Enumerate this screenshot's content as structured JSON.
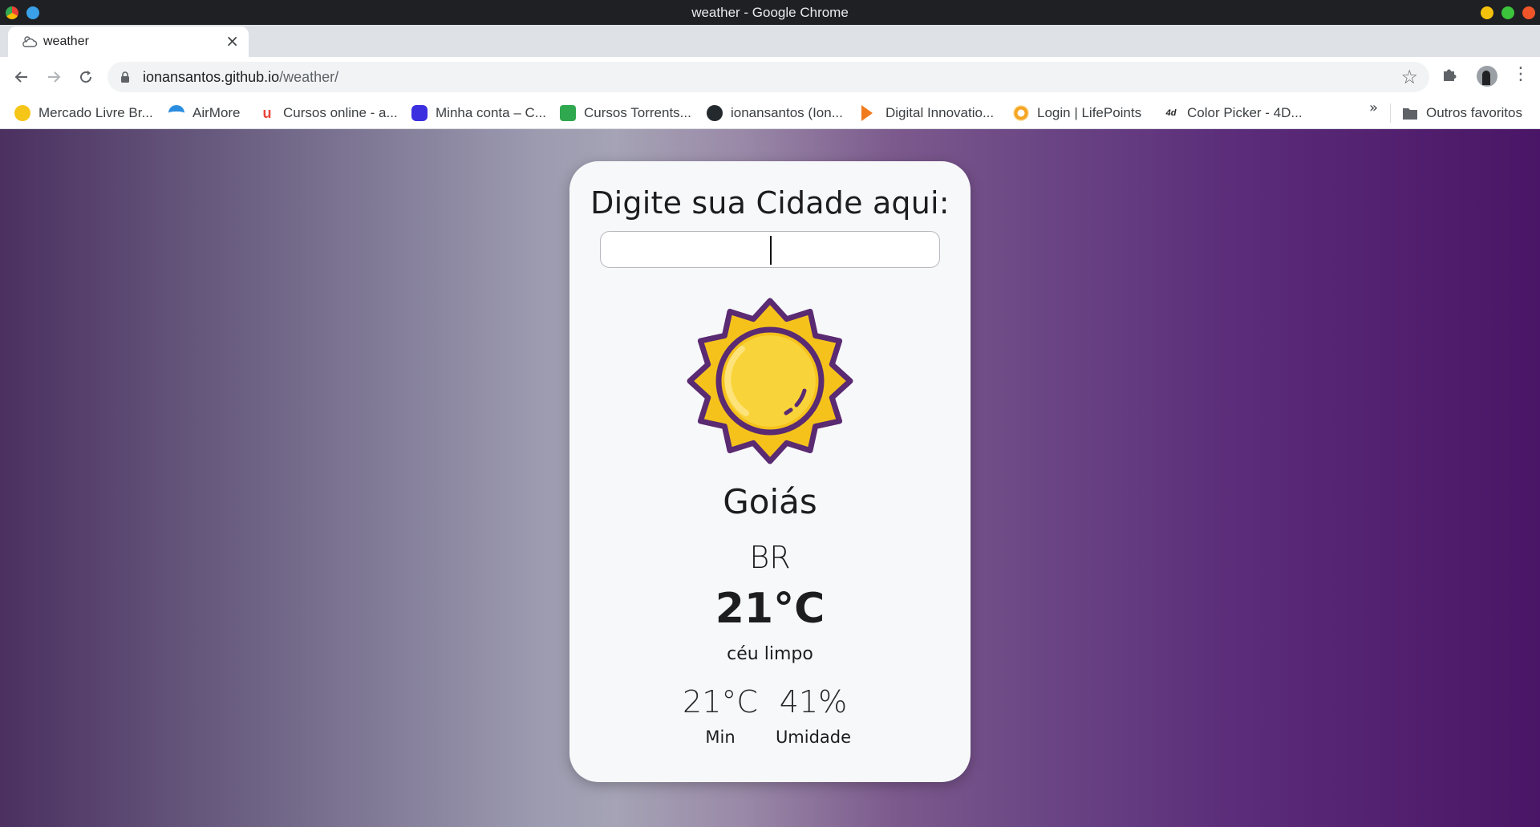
{
  "window": {
    "title": "weather - Google Chrome"
  },
  "tabs": [
    {
      "title": "weather",
      "icon": "weather-cloud-icon",
      "close_label": "×"
    }
  ],
  "new_tab_label": "+",
  "address_bar": {
    "host": "ionansantos.github.io",
    "path": "/weather/"
  },
  "bookmarks": [
    {
      "label": "Mercado Livre Br...",
      "icon": "mercadolivre-icon",
      "color": "#f5c518"
    },
    {
      "label": "AirMore",
      "icon": "airmore-icon",
      "color": "#2a8de0"
    },
    {
      "label": "Cursos online - a...",
      "icon": "udemy-icon",
      "color": "#e8453c"
    },
    {
      "label": "Minha conta – C...",
      "icon": "account-icon",
      "color": "#3b2fe0"
    },
    {
      "label": "Cursos Torrents...",
      "icon": "torrents-icon",
      "color": "#2fa84f"
    },
    {
      "label": "ionansantos (Ion...",
      "icon": "github-icon",
      "color": "#24292e"
    },
    {
      "label": "Digital Innovatio...",
      "icon": "dio-icon",
      "color": "#f07b1c"
    },
    {
      "label": "Login | LifePoints",
      "icon": "lifepoints-icon",
      "color": "#f5a623"
    },
    {
      "label": "Color Picker - 4D...",
      "icon": "colorpicker-icon",
      "color": "#222222"
    }
  ],
  "bookmarks_more": "»",
  "other_bookmarks": "Outros favoritos",
  "app": {
    "prompt": "Digite sua Cidade aqui:",
    "input_value": "",
    "city": "Goiás",
    "country": "BR",
    "temperature": "21°C",
    "description": "céu limpo",
    "min_value": "21°C",
    "min_label": "Min",
    "humidity_value": "41%",
    "humidity_label": "Umidade",
    "weather_icon": "sun-icon"
  }
}
